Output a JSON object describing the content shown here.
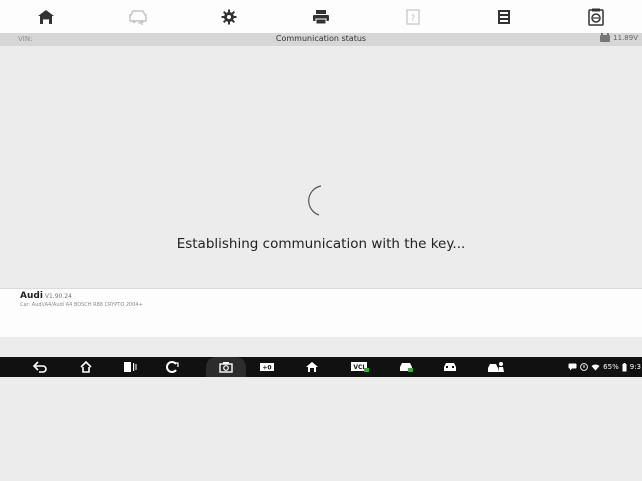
{
  "toolbar": {
    "items": [
      {
        "name": "home-icon"
      },
      {
        "name": "vehicle-swap-icon"
      },
      {
        "name": "settings-gear-icon"
      },
      {
        "name": "print-icon"
      },
      {
        "name": "help-icon"
      },
      {
        "name": "save-icon"
      },
      {
        "name": "data-logging-icon"
      }
    ]
  },
  "statusbar": {
    "vin_label": "VIN:",
    "title": "Communication status",
    "battery_voltage": "11.89V"
  },
  "main": {
    "message": "Establishing communication with the key..."
  },
  "footer": {
    "make": "Audi",
    "version": "V1.90.24",
    "car_path": "Car: Audi/A4/Audi A4 BOSCH R88 CRYPTO 2004+"
  },
  "android_nav": {
    "status": {
      "battery_percent": "65%",
      "time": "9:3"
    }
  },
  "colors": {
    "toolbar_bg": "#fdfdfd",
    "status_bg": "#d6d6d6",
    "main_bg": "#ececec",
    "icon_dark": "#333333",
    "navbar_bg": "#111111"
  }
}
